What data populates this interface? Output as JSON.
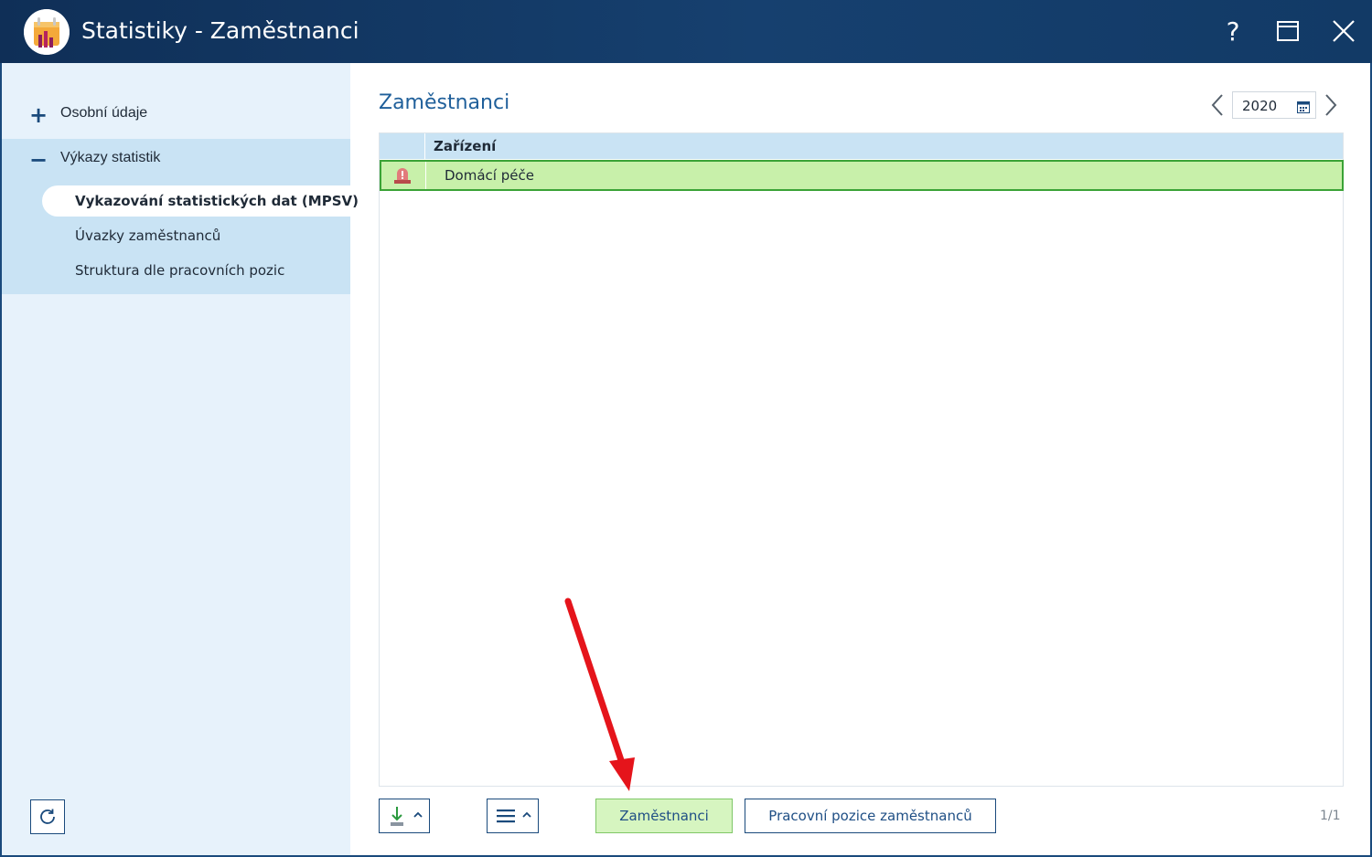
{
  "window": {
    "title": "Statistiky - Zaměstnanci",
    "help_label": "?",
    "icons": {
      "app": "statistics-chart-icon",
      "maximize": "maximize-icon",
      "close": "close-icon"
    }
  },
  "sidebar": {
    "groups": [
      {
        "label": "Osobní údaje",
        "expanded": false,
        "sign": "+"
      },
      {
        "label": "Výkazy statistik",
        "expanded": true,
        "sign": "−",
        "items": [
          {
            "label": "Vykazování statistických dat (MPSV)",
            "active": true
          },
          {
            "label": "Úvazky zaměstnanců",
            "active": false
          },
          {
            "label": "Struktura dle pracovních pozic",
            "active": false
          }
        ]
      }
    ],
    "refresh_icon": "refresh-icon"
  },
  "main": {
    "title": "Zaměstnanci",
    "year": "2020",
    "table": {
      "column_header": "Zařízení",
      "rows": [
        {
          "icon": "alert-siren-icon",
          "label": "Domácí péče",
          "selected": true
        }
      ]
    }
  },
  "toolbar": {
    "export_icon": "download-icon",
    "menu_icon": "hamburger-menu-icon",
    "employees_button": "Zaměstnanci",
    "positions_button": "Pracovní pozice zaměstnanců",
    "pager": "1/1"
  },
  "colors": {
    "titlebar": "#16406f",
    "sidebar_bg": "#e7f2fb",
    "sidebar_group_active": "#c9e3f4",
    "header_bg": "#c9e3f4",
    "row_selected": "#c8f0aa",
    "row_border": "#3aa336",
    "accent_text": "#1f5f9a",
    "annotation_arrow": "#e5141b"
  }
}
